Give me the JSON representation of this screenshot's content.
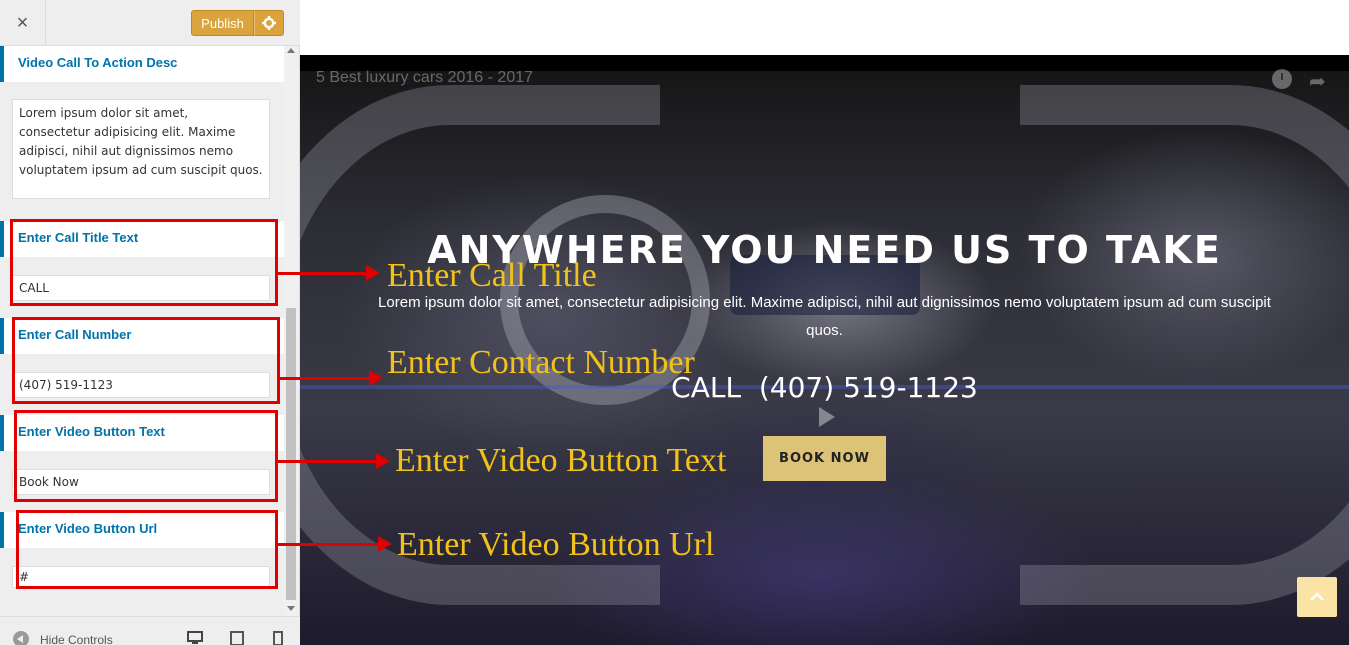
{
  "toolbar": {
    "close_label": "×",
    "publish_label": "Publish"
  },
  "panel": {
    "desc_section": {
      "title": "Video Call To Action Desc",
      "value": "Lorem ipsum dolor sit amet, consectetur adipisicing elit. Maxime adipisci, nihil aut dignissimos nemo voluptatem ipsum ad cum suscipit quos."
    },
    "call_title_section": {
      "title": "Enter Call Title Text",
      "value": "CALL"
    },
    "call_number_section": {
      "title": "Enter Call Number",
      "value": "(407) 519-1123"
    },
    "button_text_section": {
      "title": "Enter Video Button Text",
      "value": "Book Now"
    },
    "button_url_section": {
      "title": "Enter Video Button Url",
      "value": "#"
    }
  },
  "footer": {
    "hide_controls_label": "Hide Controls"
  },
  "preview": {
    "video_title": "5 Best luxury cars 2016 - 2017",
    "headline": "ANYWHERE YOU NEED US TO TAKE",
    "description": "Lorem ipsum dolor sit amet, consectetur adipisicing elit. Maxime adipisci, nihil aut dignissimos nemo voluptatem ipsum ad cum suscipit quos.",
    "call_line": "CALL  (407) 519-1123",
    "book_button": "BOOK NOW"
  },
  "annotations": {
    "call_title": "Enter Call Title",
    "contact_number": "Enter Contact Number",
    "video_button_text": "Enter Video Button Text",
    "video_button_url": "Enter Video Button Url"
  },
  "colors": {
    "accent": "#0073aa",
    "publish": "#dba33d",
    "annotation_text": "#f2c21b",
    "annotation_box": "#e00000",
    "book_button": "#dcc377"
  },
  "icons": [
    "close-icon",
    "gear-icon",
    "hide-controls-icon",
    "desktop-icon",
    "tablet-icon",
    "mobile-icon",
    "clock-icon",
    "share-icon",
    "play-icon",
    "chevron-up-icon"
  ]
}
